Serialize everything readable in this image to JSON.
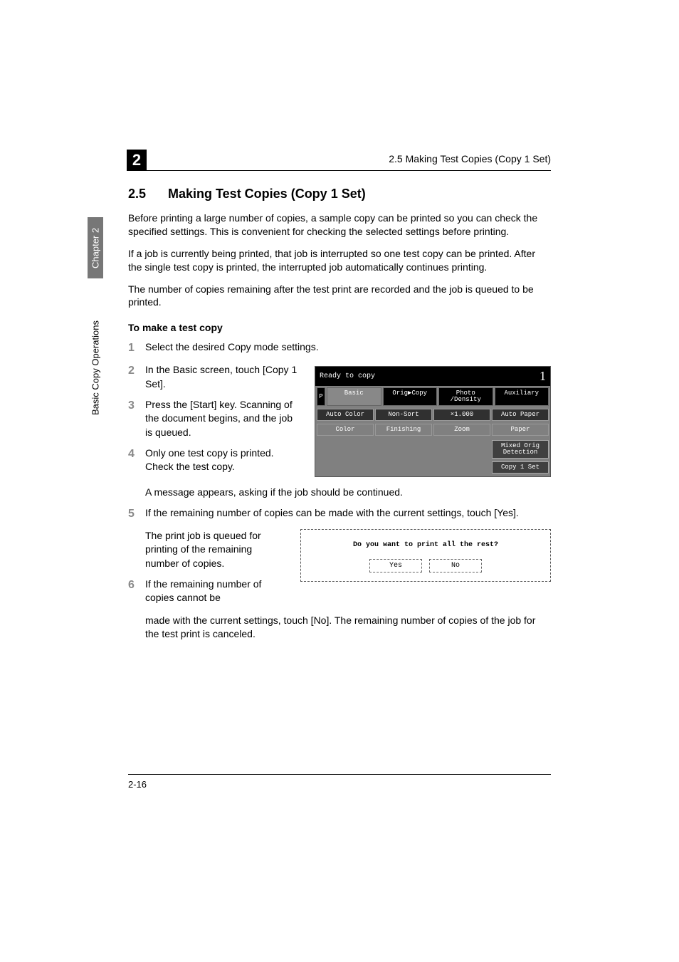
{
  "header": {
    "chapter_number": "2",
    "running_head": "2.5 Making Test Copies (Copy 1 Set)"
  },
  "sidebar": {
    "chapter_label": "Chapter 2",
    "section_label": "Basic Copy Operations"
  },
  "section": {
    "number": "2.5",
    "title": "Making Test Copies (Copy 1 Set)"
  },
  "intro": {
    "p1": "Before printing a large number of copies, a sample copy can be printed so you can check the specified settings. This is convenient for checking the selected settings before printing.",
    "p2": "If a job is currently being printed, that job is interrupted so one test copy can be printed. After the single test copy is printed, the interrupted job automatically continues printing.",
    "p3": "The number of copies remaining after the test print are recorded and the job is queued to be printed."
  },
  "procedure_heading": "To make a test copy",
  "steps": {
    "s1": {
      "num": "1",
      "text": "Select the desired Copy mode settings."
    },
    "s2": {
      "num": "2",
      "text": "In the Basic screen, touch [Copy 1 Set]."
    },
    "s3": {
      "num": "3",
      "text": "Press the [Start] key. Scanning of the document begins, and the job is queued."
    },
    "s4": {
      "num": "4",
      "text": "Only one test copy is printed. Check the test copy.",
      "sub": "A message appears, asking if the job should be continued."
    },
    "s5": {
      "num": "5",
      "text": "If the remaining number of copies can be made with the current settings, touch [Yes].",
      "sub": "The print job is queued for printing of the remaining number of copies."
    },
    "s6": {
      "num": "6",
      "text": "If the remaining number of copies cannot be made with the current settings, touch [No]. The remaining number of copies of the job for the test print is canceled."
    }
  },
  "lcd1": {
    "status": "Ready to copy",
    "count": "1",
    "tabs": {
      "basic": "Basic",
      "orig": "Orig▶Copy",
      "photo": "Photo /Density",
      "aux": "Auxiliary"
    },
    "row1": {
      "auto": "Auto Color",
      "sort": "Non-Sort",
      "zoomv": "×1.000",
      "paper": "Auto Paper"
    },
    "row2": {
      "color": "Color",
      "finish": "Finishing",
      "zoom": "Zoom",
      "paperl": "Paper"
    },
    "mixed": "Mixed Orig Detection",
    "copy1": "Copy 1 Set"
  },
  "lcd2": {
    "question": "Do you want to print all the rest?",
    "yes": "Yes",
    "no": "No"
  },
  "footer": {
    "page": "2-16"
  }
}
